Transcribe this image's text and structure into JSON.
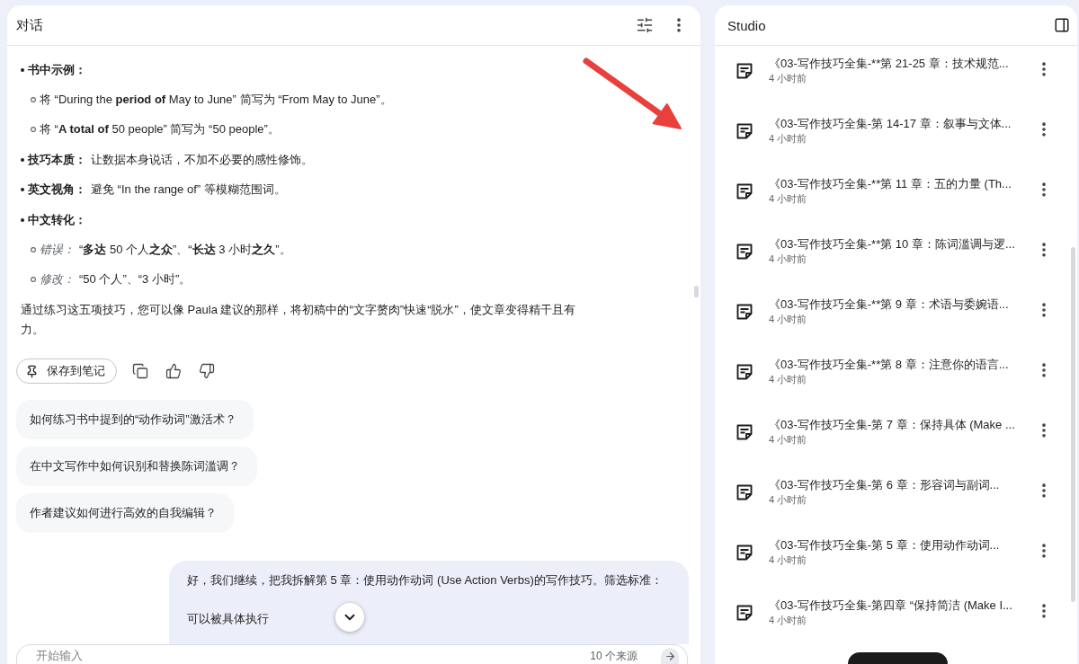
{
  "conversation": {
    "title": "对话"
  },
  "answer": {
    "items": [
      {
        "label": "书中示例：",
        "children": [
          {
            "text": "将 “During the **period of** May to June” 简写为 “From May to June”。"
          },
          {
            "text": "将 “**A total of** 50 people” 简写为 “50 people”。"
          }
        ]
      },
      {
        "label": "技巧本质：",
        "text": "让数据本身说话，不加不必要的感性修饰。"
      },
      {
        "label": "英文视角：",
        "text": "避免 “In the range of” 等模糊范围词。"
      },
      {
        "label": "中文转化：",
        "children": [
          {
            "label": "错误：",
            "text": "“**多达** 50 个人**之众**”、“**长达** 3 小时**之久**”。"
          },
          {
            "label": "修改：",
            "text": "“50 个人”、“3 小时”。"
          }
        ]
      }
    ],
    "paragraph": "通过练习这五项技巧，您可以像 Paula 建议的那样，将初稿中的“文字赘肉”快速“脱水”，使文章变得精干且有力。"
  },
  "actions": {
    "save_label": "保存到笔记"
  },
  "suggestions": [
    "如何练习书中提到的“动作动词”激活术？",
    "在中文写作中如何识别和替换陈词滥调？",
    "作者建议如何进行高效的自我编辑？"
  ],
  "user_message": {
    "paragraphs": [
      "好，我们继续，把我拆解第 5 章：使用动作动词 (Use Action Verbs)的写作技巧。筛选标准：",
      "可以被具体执行"
    ]
  },
  "composer": {
    "placeholder": "开始输入",
    "source_count": "10 个来源"
  },
  "studio": {
    "title": "Studio",
    "notes": [
      {
        "title": "《03-写作技巧全集-**第 21-25 章：技术规范...",
        "time": "4 小时前"
      },
      {
        "title": "《03-写作技巧全集-第 14-17 章：叙事与文体...",
        "time": "4 小时前"
      },
      {
        "title": "《03-写作技巧全集-**第 11 章：五的力量 (Th...",
        "time": "4 小时前"
      },
      {
        "title": "《03-写作技巧全集-**第 10 章：陈词滥调与逻...",
        "time": "4 小时前"
      },
      {
        "title": "《03-写作技巧全集-**第 9 章：术语与委婉语...",
        "time": "4 小时前"
      },
      {
        "title": "《03-写作技巧全集-**第 8 章：注意你的语言...",
        "time": "4 小时前"
      },
      {
        "title": "《03-写作技巧全集-第 7 章：保持具体 (Make ...",
        "time": "4 小时前"
      },
      {
        "title": "《03-写作技巧全集-第 6 章：形容词与副词...",
        "time": "4 小时前"
      },
      {
        "title": "《03-写作技巧全集-第 5 章：使用动作动词...",
        "time": "4 小时前"
      },
      {
        "title": "《03-写作技巧全集-第四章 “保持简洁 (Make I...",
        "time": "4 小时前"
      }
    ]
  }
}
